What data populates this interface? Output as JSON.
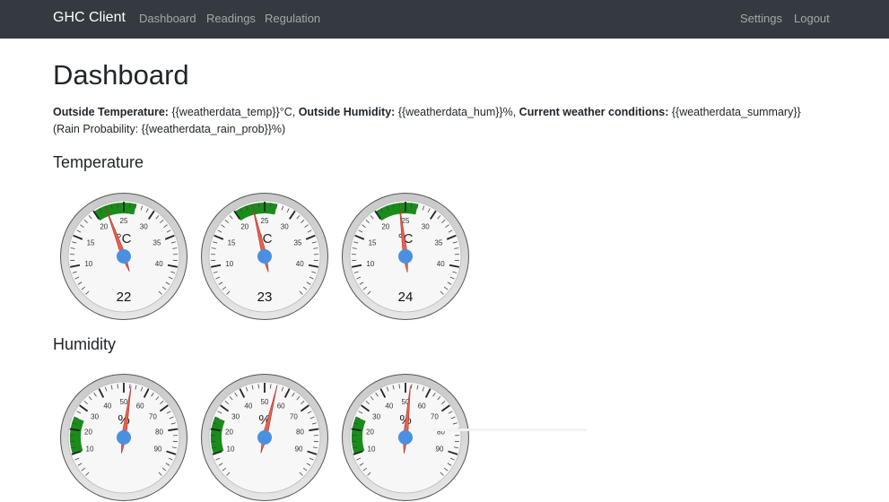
{
  "nav": {
    "brand": "GHC Client",
    "left_items": [
      "Dashboard",
      "Readings",
      "Regulation"
    ],
    "right_items": [
      "Settings",
      "Logout"
    ]
  },
  "page": {
    "title": "Dashboard"
  },
  "weather": {
    "temp_label": "Outside Temperature:",
    "temp_value": "{{weatherdata_temp}}°C,",
    "hum_label": "Outside Humidity:",
    "hum_value": "{{weatherdata_hum}}%,",
    "summary_label": "Current weather conditions:",
    "summary_value": "{{weatherdata_summary}}",
    "rain_text": "(Rain Probability: {{weatherdata_rain_prob}}%)"
  },
  "sections": {
    "temperature": "Temperature",
    "humidity": "Humidity"
  },
  "colors": {
    "navbar_bg": "#343a40",
    "green_zone": "#1a8c1a",
    "needle": "#e8624a",
    "hub": "#4a90e2",
    "bezel": "#d0d0d0"
  },
  "temperature_gauges": {
    "unit": "°C",
    "min": 5,
    "max": 45,
    "major_ticks": [
      10,
      15,
      20,
      25,
      30,
      35,
      40
    ],
    "green_zone": [
      20,
      27
    ],
    "readings": [
      {
        "value": 22,
        "display": "22"
      },
      {
        "value": 23,
        "display": "23"
      },
      {
        "value": 24,
        "display": "24"
      }
    ]
  },
  "humidity_gauges": {
    "unit": "%",
    "min": 0,
    "max": 100,
    "major_ticks": [
      10,
      20,
      30,
      40,
      50,
      60,
      70,
      80,
      90
    ],
    "green_zone": [
      10,
      25
    ],
    "readings": [
      {
        "value": 53
      },
      {
        "value": 55
      },
      {
        "value": 52
      }
    ]
  }
}
